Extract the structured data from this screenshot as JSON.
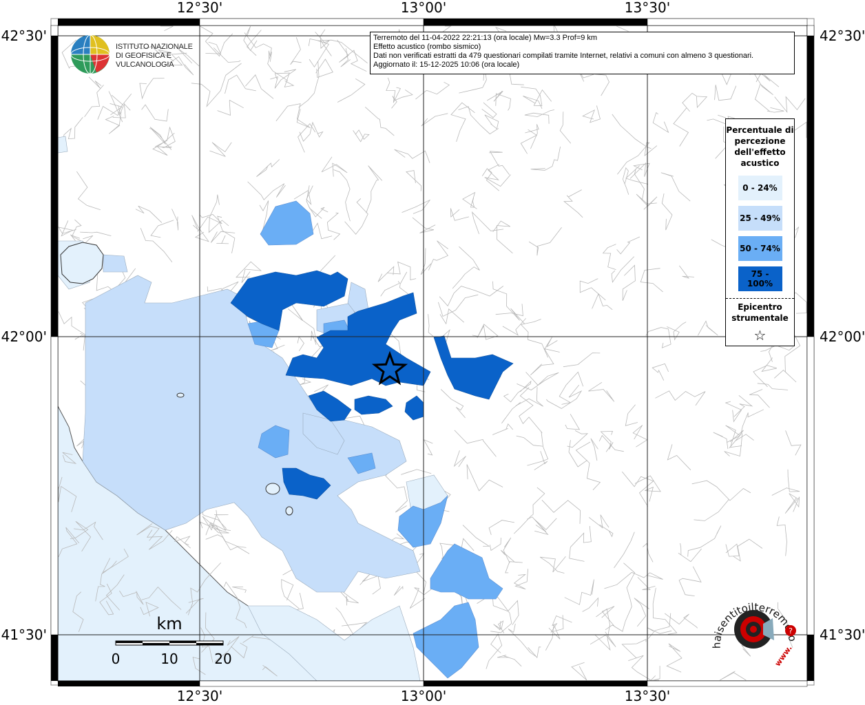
{
  "info_box": {
    "line1": "Terremoto del 11-04-2022 22:21:13 (ora locale) Mw=3.3 Prof=9 km",
    "line2": "Effetto acustico (rombo sismico)",
    "line3": "Dati non verificati estratti da 479 questionari compilati tramite Internet, relativi a comuni con almeno 3 questionari.",
    "line4": "Aggiornato il: 15-12-2025 10:06 (ora locale)"
  },
  "logo": {
    "line1": "ISTITUTO NAZIONALE",
    "line2": "DI GEOFISICA E VULCANOLOGIA"
  },
  "axes": {
    "top": [
      "12°30'",
      "13°00'",
      "13°30'"
    ],
    "bottom": [
      "12°30'",
      "13°00'",
      "13°30'"
    ],
    "left": [
      "42°30'",
      "42°00'",
      "41°30'"
    ],
    "right": [
      "42°30'",
      "42°00'",
      "41°30'"
    ]
  },
  "legend": {
    "title": "Percentuale di percezione dell'effetto acustico",
    "classes": [
      {
        "label": "0 - 24%",
        "color": "#e3f1fc"
      },
      {
        "label": "25 - 49%",
        "color": "#c6defa"
      },
      {
        "label": "50 - 74%",
        "color": "#6aaef5"
      },
      {
        "label": "75 - 100%",
        "color": "#0a62c9"
      }
    ],
    "epicenter_label": "Epicentro strumentale",
    "epicenter_symbol": "☆"
  },
  "scale": {
    "unit": "km",
    "labels": [
      "0",
      "10",
      "20"
    ]
  },
  "watermark": {
    "text": "haisentitoilterremoto.it",
    "url": "www."
  },
  "colors": {
    "sea": "#e3f1fc",
    "boundary": "#b4b4b4",
    "epicenter": "#000000"
  }
}
